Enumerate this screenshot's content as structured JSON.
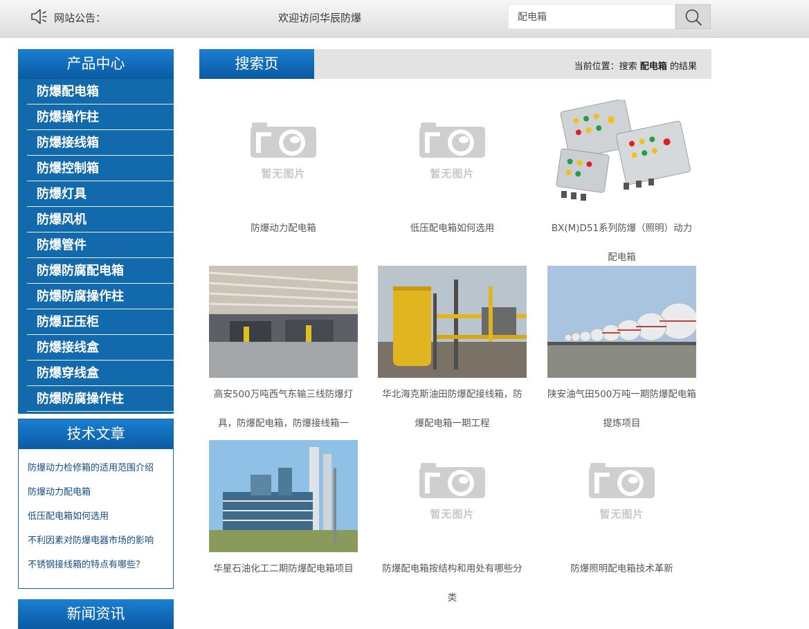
{
  "topbar": {
    "notice_icon": "speaker-icon",
    "notice_label": "网站公告：",
    "notice_text": "欢迎访问华辰防爆",
    "search_value": "配电箱",
    "search_icon": "search-icon"
  },
  "sidebar": {
    "products_title": "产品中心",
    "products": [
      "防爆配电箱",
      "防爆操作柱",
      "防爆接线箱",
      "防爆控制箱",
      "防爆灯具",
      "防爆风机",
      "防爆管件",
      "防爆防腐配电箱",
      "防爆防腐操作柱",
      "防爆正压柜",
      "防爆接线盒",
      "防爆穿线盒",
      "防爆防腐操作柱"
    ],
    "articles_title": "技术文章",
    "articles": [
      "防爆动力检修箱的适用范围介绍",
      "防爆动力配电箱",
      "低压配电箱如何选用",
      "不利因素对防爆电器市场的影响",
      "不锈钢接线箱的特点有哪些？"
    ],
    "news_title": "新闻资讯"
  },
  "main": {
    "tab_label": "搜索页",
    "crumb_prefix": "当前位置：搜索",
    "crumb_keyword": "配电箱",
    "crumb_suffix": "的结果",
    "no_image_text": "暂无图片",
    "results": [
      {
        "title": "防爆动力配电箱",
        "image": "no-image-placeholder"
      },
      {
        "title": "低压配电箱如何选用",
        "image": "no-image-placeholder"
      },
      {
        "title": "BX(M)D51系列防爆（照明）动力配电箱",
        "image": "explosion-proof-boxes-photo"
      },
      {
        "title": "高安500万吨西气东输三线防爆灯具，防爆配电箱，防爆接线箱一",
        "image": "factory-hall-photo"
      },
      {
        "title": "华北海克斯油田防爆配接线箱，防爆配电箱一期工程",
        "image": "oilfield-tank-photo"
      },
      {
        "title": "陕安油气田500万吨一期防爆配电箱提炼项目",
        "image": "gas-spheres-photo"
      },
      {
        "title": "华星石油化工二期防爆配电箱项目",
        "image": "refinery-towers-photo"
      },
      {
        "title": "防爆配电箱按结构和用处有哪些分类",
        "image": "no-image-placeholder"
      },
      {
        "title": "防爆照明配电箱技术革新",
        "image": "no-image-placeholder"
      }
    ]
  },
  "colors": {
    "accent_blue": "#1269ab",
    "header_blue": "#0a5aa3",
    "crumb_gray": "#e3e3e3"
  }
}
